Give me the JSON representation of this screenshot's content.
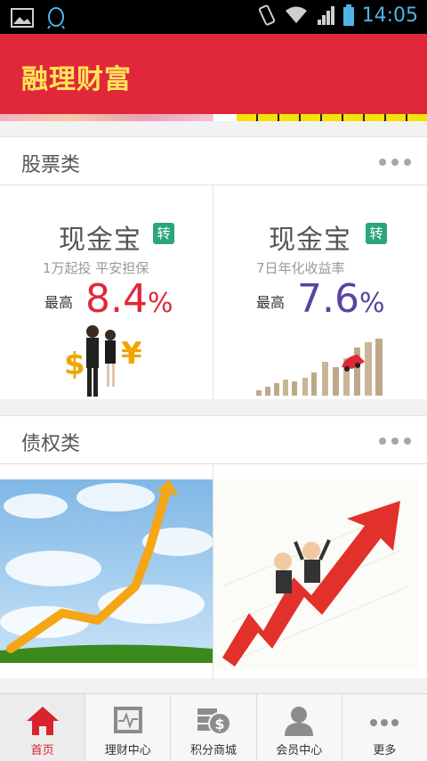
{
  "status_bar": {
    "time": "14:05"
  },
  "header": {
    "title": "融理财富"
  },
  "sections": [
    {
      "title": "股票类",
      "cards": [
        {
          "title": "现金宝",
          "badge": "转",
          "subtitle": "1万起投  平安担保",
          "rate_label": "最高",
          "rate_value": "8.4",
          "rate_unit": "%",
          "rate_color": "#e0283a"
        },
        {
          "title": "现金宝",
          "badge": "转",
          "subtitle": "7日年化收益率",
          "rate_label": "最高",
          "rate_value": "7.6",
          "rate_unit": "%",
          "rate_color": "#5a43a0"
        }
      ]
    },
    {
      "title": "债权类"
    }
  ],
  "tabbar": {
    "tabs": [
      {
        "label": "首页",
        "icon": "home-icon",
        "active": true
      },
      {
        "label": "理财中心",
        "icon": "chart-monitor-icon"
      },
      {
        "label": "积分商城",
        "icon": "coins-dollar-icon"
      },
      {
        "label": "会员中心",
        "icon": "user-icon"
      },
      {
        "label": "更多",
        "icon": "more-dots-icon"
      }
    ]
  },
  "colors": {
    "brand_red": "#e0283a",
    "title_yellow": "#ffe35a",
    "badge_green": "#2aa67a",
    "status_blue": "#4fb3e8"
  }
}
